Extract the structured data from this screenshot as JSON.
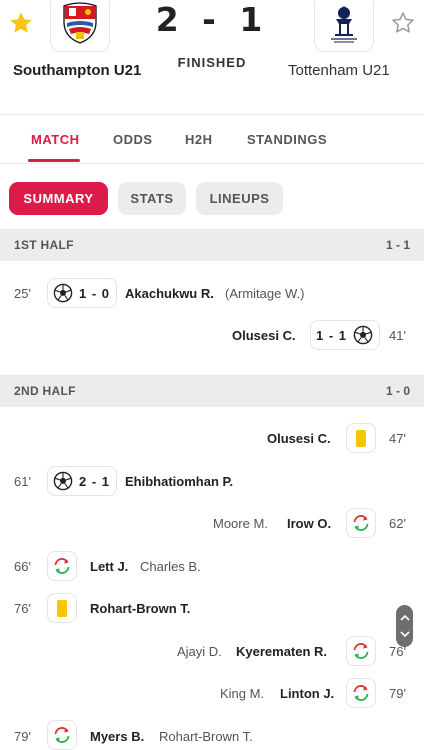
{
  "match": {
    "home_team": "Southampton U21",
    "away_team": "Tottenham U21",
    "score": "2 - 1",
    "status": "FINISHED"
  },
  "tabs": [
    "MATCH",
    "ODDS",
    "H2H",
    "STANDINGS"
  ],
  "subtabs": [
    "SUMMARY",
    "STATS",
    "LINEUPS"
  ],
  "first_half": {
    "label": "1ST HALF",
    "score": "1 - 1",
    "events": [
      {
        "minute": "25'",
        "score": "1 - 0",
        "player": "Akachukwu R.",
        "assist": "(Armitage W.)"
      },
      {
        "minute": "41'",
        "score": "1 - 1",
        "player": "Olusesi C."
      }
    ]
  },
  "second_half": {
    "label": "2ND HALF",
    "score": "1 - 0",
    "events": [
      {
        "minute": "47'",
        "player": "Olusesi C."
      },
      {
        "minute": "61'",
        "score": "2 - 1",
        "player": "Ehibhatiomhan P."
      },
      {
        "minute": "62'",
        "player": "Irow O.",
        "sub_out": "Moore M."
      },
      {
        "minute": "66'",
        "player": "Lett J.",
        "sub_out": "Charles B."
      },
      {
        "minute": "76'",
        "player": "Rohart-Brown T."
      },
      {
        "minute": "76'",
        "player": "Kyerematen R.",
        "sub_out": "Ajayi D."
      },
      {
        "minute": "79'",
        "player": "Linton J.",
        "sub_out": "King M."
      },
      {
        "minute": "79'",
        "player": "Myers B.",
        "sub_out": "Rohart-Brown T."
      }
    ]
  },
  "colors": {
    "accent": "#dd1b4a",
    "favorite_star": "#f6c516",
    "yellow_card": "#f7c600",
    "sub_in": "#2bb24c",
    "sub_out": "#e0322d"
  },
  "icons": [
    "favorite-star-icon",
    "star-outline-icon",
    "ball-icon",
    "yellow-card-icon",
    "substitution-icon",
    "chevron-up-icon",
    "chevron-down-icon"
  ]
}
